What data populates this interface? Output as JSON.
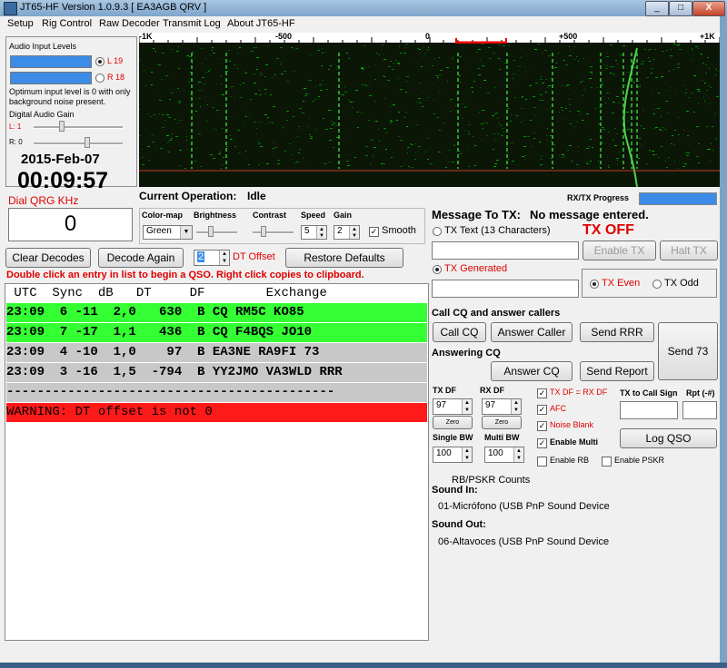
{
  "window": {
    "title": "JT65-HF Version 1.0.9.3 [ EA3AGB QRV ]"
  },
  "menu": [
    "Setup",
    "Rig Control",
    "Raw Decoder",
    "Transmit Log",
    "About JT65-HF"
  ],
  "left_panel": {
    "audio_title": "Audio Input Levels",
    "left_label": "L 19",
    "right_label": "R 18",
    "hint": "Optimum input level is 0 with only background noise present.",
    "gain_title": "Digital Audio Gain",
    "gain_l": "L: 1",
    "gain_r": "R: 0",
    "date": "2015-Feb-07",
    "time": "00:09:57",
    "dial_label": "Dial QRG KHz",
    "dial_value": "0"
  },
  "scale": {
    "t1": "-1K",
    "t2": "-500",
    "t3": "0",
    "t4": "+500",
    "t5": "+1K"
  },
  "status": {
    "current_op_label": "Current Operation:",
    "current_op_value": "Idle",
    "progress_label": "RX/TX Progress"
  },
  "controls": {
    "colormap_label": "Color-map",
    "colormap_value": "Green",
    "brightness_label": "Brightness",
    "contrast_label": "Contrast",
    "speed_label": "Speed",
    "speed_value": "5",
    "gain_label": "Gain",
    "gain_value": "2",
    "smooth_label": "Smooth"
  },
  "buttons": {
    "clear_decodes": "Clear Decodes",
    "decode_again": "Decode Again",
    "dt_value": "2",
    "dt_label": "DT Offset",
    "restore": "Restore Defaults"
  },
  "hint_line": "Double click an entry in list to begin a QSO.  Right click copies to clipboard.",
  "decodes": {
    "header": " UTC  Sync  dB   DT     DF        Exchange",
    "rows": [
      "23:09  6 -11  2,0   630  B CQ RM5C KO85",
      "23:09  7 -17  1,1   436  B CQ F4BQS JO10",
      "23:09  4 -10  1,0    97  B EA3NE RA9FI 73",
      "23:09  3 -16  1,5  -794  B YY2JMO VA3WLD RRR"
    ],
    "divider": "-------------------------------------------",
    "warning": "WARNING: DT offset is not 0"
  },
  "tx": {
    "message_label": "Message To TX:",
    "message_value": "No message entered.",
    "tx_text_label": "TX Text (13 Characters)",
    "tx_off": "TX OFF",
    "enable_tx": "Enable TX",
    "halt_tx": "Halt TX",
    "tx_generated": "TX Generated",
    "tx_even": "TX Even",
    "tx_odd": "TX Odd",
    "cq_title": "Call CQ and answer callers",
    "call_cq": "Call CQ",
    "answer_caller": "Answer Caller",
    "send_rrr": "Send RRR",
    "send_73": "Send 73",
    "answering_title": "Answering CQ",
    "answer_cq": "Answer CQ",
    "send_report": "Send Report",
    "tx_df_label": "TX DF",
    "tx_df_value": "97",
    "rx_df_label": "RX DF",
    "rx_df_value": "97",
    "zero": "Zero",
    "tx_eq_rx": "TX DF = RX DF",
    "afc": "AFC",
    "noise_blank": "Noise Blank",
    "enable_multi": "Enable Multi",
    "tx_call_label": "TX to Call Sign",
    "rpt_label": "Rpt (-#)",
    "log_qso": "Log QSO",
    "single_bw_label": "Single BW",
    "single_bw_value": "100",
    "multi_bw_label": "Multi BW",
    "multi_bw_value": "100",
    "enable_rb": "Enable RB",
    "enable_pskr": "Enable PSKR",
    "rb_counts": "RB/PSKR Counts",
    "sound_in_label": "Sound In:",
    "sound_in_value": "01-Micrófono (USB PnP Sound Device",
    "sound_out_label": "Sound Out:",
    "sound_out_value": "06-Altavoces (USB PnP Sound Device"
  },
  "colors": {
    "green_row": "#33ff33",
    "gray_row": "#c8c8c8",
    "warning": "#ff1a1a",
    "accent": "#3c8ce7"
  }
}
